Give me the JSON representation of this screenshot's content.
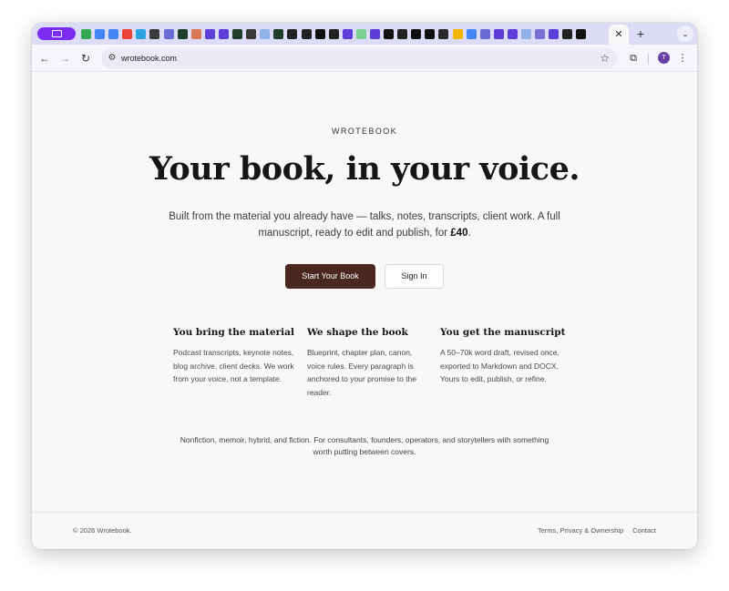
{
  "browser": {
    "tab_icons": [
      {
        "name": "drive-icon",
        "color": "#34a853"
      },
      {
        "name": "docs-icon",
        "color": "#4285f4"
      },
      {
        "name": "docs-icon",
        "color": "#4285f4"
      },
      {
        "name": "gmail-icon",
        "color": "#ea4335"
      },
      {
        "name": "telegram-icon",
        "color": "#2aa3df"
      },
      {
        "name": "app-icon",
        "color": "#3a3a3a"
      },
      {
        "name": "browser-icon",
        "color": "#6b6bd6"
      },
      {
        "name": "activity-icon",
        "color": "#1f3d2b"
      },
      {
        "name": "claude-icon",
        "color": "#d97757"
      },
      {
        "name": "app-icon",
        "color": "#5b3fd6"
      },
      {
        "name": "app-icon",
        "color": "#5b3fd6"
      },
      {
        "name": "activity-icon",
        "color": "#1f3d2b"
      },
      {
        "name": "app-icon",
        "color": "#3a3a3a"
      },
      {
        "name": "brain-icon",
        "color": "#8fb3e8"
      },
      {
        "name": "activity-icon",
        "color": "#1f3d2b"
      },
      {
        "name": "caret-icon",
        "color": "#222222"
      },
      {
        "name": "caret-icon",
        "color": "#222222"
      },
      {
        "name": "triangle-icon",
        "color": "#111111"
      },
      {
        "name": "github-icon",
        "color": "#222222"
      },
      {
        "name": "app-icon",
        "color": "#5b3fd6"
      },
      {
        "name": "sheets-icon",
        "color": "#7ad08f"
      },
      {
        "name": "app-icon",
        "color": "#5b3fd6"
      },
      {
        "name": "triangle-icon",
        "color": "#111111"
      },
      {
        "name": "c-icon",
        "color": "#222222"
      },
      {
        "name": "triangle-icon",
        "color": "#111111"
      },
      {
        "name": "triangle-icon",
        "color": "#111111"
      },
      {
        "name": "app-icon",
        "color": "#2a2a2a"
      },
      {
        "name": "chart-icon",
        "color": "#f4b400"
      },
      {
        "name": "google-icon",
        "color": "#4285f4"
      },
      {
        "name": "app-icon",
        "color": "#6b6bd6"
      },
      {
        "name": "app-icon",
        "color": "#5b3fd6"
      },
      {
        "name": "app-icon",
        "color": "#5b3fd6"
      },
      {
        "name": "brain-icon",
        "color": "#8fb3e8"
      },
      {
        "name": "api-icon",
        "color": "#7a6fd6"
      },
      {
        "name": "shield-icon",
        "color": "#5b3fd6"
      },
      {
        "name": "c-icon",
        "color": "#222222"
      },
      {
        "name": "triangle-icon",
        "color": "#111111"
      }
    ],
    "url": "wrotebook.com",
    "profile_initial": "T"
  },
  "page": {
    "eyebrow": "WROTEBOOK",
    "hero_title": "Your book, in your voice.",
    "hero_sub": "Built from the material you already have — talks, notes, transcripts, client work. A full manuscript, ready to edit and publish, for ",
    "hero_price": "£40",
    "hero_sub_end": ".",
    "cta_primary": "Start Your Book",
    "cta_secondary": "Sign In",
    "features": [
      {
        "title": "You bring the material",
        "body": "Podcast transcripts, keynote notes, blog archive, client decks. We work from your voice, not a template."
      },
      {
        "title": "We shape the book",
        "body": "Blueprint, chapter plan, canon, voice rules. Every paragraph is anchored to your promise to the reader."
      },
      {
        "title": "You get the manuscript",
        "body": "A 50–70k word draft, revised once, exported to Markdown and DOCX. Yours to edit, publish, or refine."
      }
    ],
    "audience": "Nonfiction, memoir, hybrid, and fiction. For consultants, founders, operators, and storytellers with something worth putting between covers.",
    "footer": {
      "copyright": "© 2026 Wrotebook.",
      "links": [
        "Terms, Privacy & Ownership",
        "Contact"
      ]
    }
  },
  "colors": {
    "accent": "#4a2720",
    "tab_group": "#7a2cf0",
    "page_bg": "#f9f8f6"
  }
}
